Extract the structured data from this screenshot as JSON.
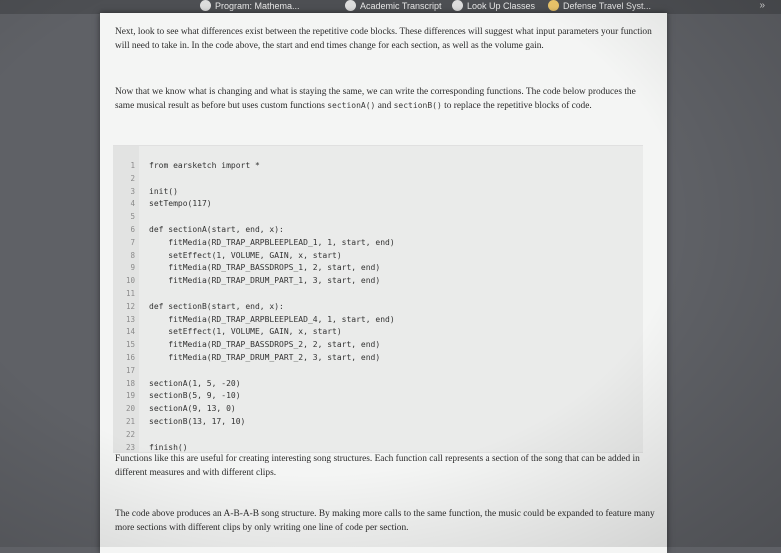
{
  "topbar": {
    "items": [
      {
        "label": "Program: Mathema...",
        "icon": "page-icon"
      },
      {
        "label": "Academic Transcript",
        "icon": "globe-icon"
      },
      {
        "label": "Look Up Classes",
        "icon": "globe-icon"
      },
      {
        "label": "Defense Travel Syst...",
        "icon": "eagle-icon"
      }
    ],
    "more": "»"
  },
  "text": {
    "p1": "Next, look to see what differences exist between the repetitive code blocks. These differences will suggest what input parameters your function will need to take in. In the code above, the start and end times change for each section, as well as the volume gain.",
    "p2a": "Now that we know what is changing and what is staying the same, we can write the corresponding functions. The code below produces the same musical result as before but uses custom functions ",
    "p2_code1": "sectionA()",
    "p2_and": " and ",
    "p2_code2": "sectionB()",
    "p2b": " to replace the repetitive blocks of code.",
    "p3": "Functions like this are useful for creating interesting song structures. Each function call represents a section of the song that can be added in different measures and with different clips.",
    "p4": "The code above produces an A-B-A-B song structure. By making more calls to the same function, the music could be expanded to feature many more sections with different clips by only writing one line of code per section."
  },
  "code": {
    "line_numbers": [
      "1",
      "2",
      "3",
      "4",
      "5",
      "6",
      "7",
      "8",
      "9",
      "10",
      "11",
      "12",
      "13",
      "14",
      "15",
      "16",
      "17",
      "18",
      "19",
      "20",
      "21",
      "22",
      "23"
    ],
    "lines": [
      "from earsketch import *",
      "",
      "init()",
      "setTempo(117)",
      "",
      "def sectionA(start, end, x):",
      "    fitMedia(RD_TRAP_ARPBLEEPLEAD_1, 1, start, end)",
      "    setEffect(1, VOLUME, GAIN, x, start)",
      "    fitMedia(RD_TRAP_BASSDROPS_1, 2, start, end)",
      "    fitMedia(RD_TRAP_DRUM_PART_1, 3, start, end)",
      "",
      "def sectionB(start, end, x):",
      "    fitMedia(RD_TRAP_ARPBLEEPLEAD_4, 1, start, end)",
      "    setEffect(1, VOLUME, GAIN, x, start)",
      "    fitMedia(RD_TRAP_BASSDROPS_2, 2, start, end)",
      "    fitMedia(RD_TRAP_DRUM_PART_2, 3, start, end)",
      "",
      "sectionA(1, 5, -20)",
      "sectionB(5, 9, -10)",
      "sectionA(9, 13, 0)",
      "sectionB(13, 17, 10)",
      "",
      "finish()"
    ]
  }
}
